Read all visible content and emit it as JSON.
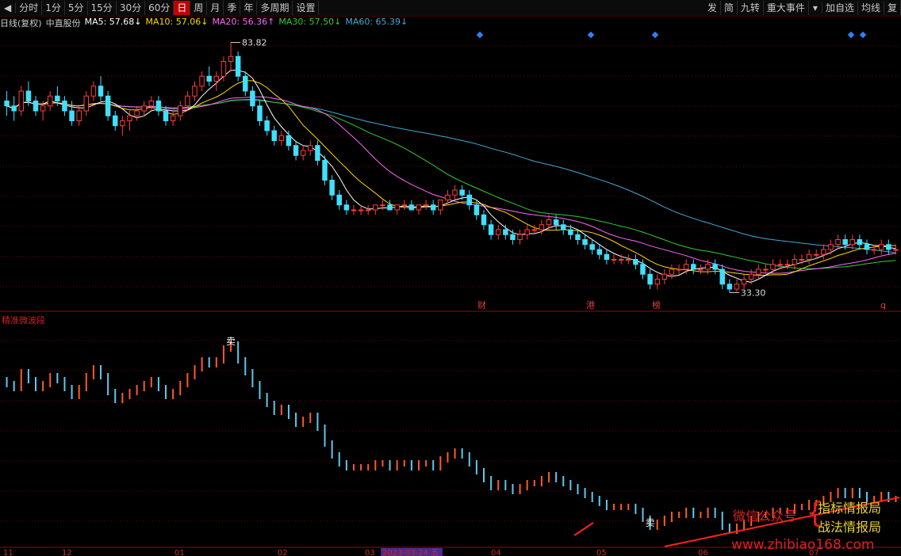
{
  "toolbar": {
    "periods": [
      "分时",
      "1分",
      "5分",
      "15分",
      "30分",
      "60分",
      "日",
      "周",
      "月",
      "季",
      "年",
      "多周期",
      "设置"
    ],
    "active_period": "日",
    "right_items": [
      "发",
      "简",
      "九转",
      "重大事件",
      "加自选",
      "均线",
      "复"
    ]
  },
  "info": {
    "chart_type_label": "日线(复权)",
    "stock_name": "中直股份",
    "ma5": "MA5: 57.68↓",
    "ma10": "MA10: 57.06↓",
    "ma20": "MA20: 56.36↑",
    "ma30": "MA30: 57.50↓",
    "ma60": "MA60: 65.39↓"
  },
  "colors": {
    "up": "#ff3c3c",
    "down": "#40e0ff",
    "ma5": "#ffffff",
    "ma10": "#ffd700",
    "ma20": "#ff66ff",
    "ma30": "#33cc33",
    "ma60": "#3fa9d6",
    "grid": "#7a0000"
  },
  "subchart_title": "精准微波段",
  "event_labels": [
    "财",
    "港",
    "榜",
    "q"
  ],
  "watermark": {
    "line1": "微信公众号",
    "line2": "指标情报局",
    "line3": "战法情报局",
    "url": "www.zhibiao168.com"
  },
  "chart_data": {
    "type": "candlestick",
    "title": "",
    "max_label": "83.82",
    "min_label": "33.30",
    "signal_labels": [
      "卖",
      "卖"
    ],
    "x_ticks": [
      "11",
      "12",
      "01",
      "02",
      "03",
      "2023-03-24 五",
      "04",
      "05",
      "06",
      "07"
    ],
    "ohlc": [
      [
        72,
        74,
        69,
        71
      ],
      [
        71,
        73,
        68,
        70
      ],
      [
        70,
        75,
        69,
        74
      ],
      [
        74,
        76,
        71,
        72
      ],
      [
        72,
        73,
        69,
        70
      ],
      [
        70,
        72,
        68,
        71
      ],
      [
        71,
        74,
        70,
        73
      ],
      [
        73,
        75,
        71,
        72
      ],
      [
        72,
        73,
        69,
        70
      ],
      [
        70,
        72,
        67,
        68
      ],
      [
        68,
        71,
        67,
        70
      ],
      [
        70,
        74,
        69,
        73
      ],
      [
        73,
        76,
        72,
        75
      ],
      [
        75,
        77,
        72,
        73
      ],
      [
        73,
        74,
        68,
        69
      ],
      [
        69,
        70,
        66,
        67
      ],
      [
        67,
        69,
        65,
        68
      ],
      [
        68,
        70,
        66,
        69
      ],
      [
        69,
        71,
        68,
        70
      ],
      [
        70,
        72,
        69,
        71
      ],
      [
        71,
        73,
        70,
        72
      ],
      [
        72,
        73,
        69,
        70
      ],
      [
        70,
        71,
        67,
        68
      ],
      [
        68,
        70,
        67,
        69
      ],
      [
        69,
        72,
        68,
        71
      ],
      [
        71,
        74,
        70,
        73
      ],
      [
        73,
        76,
        72,
        75
      ],
      [
        75,
        78,
        74,
        77
      ],
      [
        77,
        79,
        75,
        76
      ],
      [
        76,
        78,
        74,
        77
      ],
      [
        77,
        81,
        76,
        80
      ],
      [
        80,
        83.82,
        78,
        81
      ],
      [
        81,
        82,
        76,
        77
      ],
      [
        77,
        78,
        73,
        74
      ],
      [
        74,
        75,
        70,
        71
      ],
      [
        71,
        72,
        67,
        68
      ],
      [
        68,
        69,
        65,
        66
      ],
      [
        66,
        67,
        63,
        64
      ],
      [
        64,
        66,
        63,
        65
      ],
      [
        65,
        66,
        62,
        63
      ],
      [
        63,
        64,
        60,
        61
      ],
      [
        61,
        63,
        60,
        62
      ],
      [
        62,
        64,
        61,
        63
      ],
      [
        63,
        64,
        59,
        60
      ],
      [
        60,
        61,
        55,
        56
      ],
      [
        56,
        57,
        52,
        53
      ],
      [
        53,
        54,
        50,
        51
      ],
      [
        51,
        52,
        49,
        50
      ],
      [
        50,
        51,
        49,
        50
      ],
      [
        50,
        51,
        49,
        50
      ],
      [
        50,
        51,
        49,
        50
      ],
      [
        50,
        51,
        49,
        51
      ],
      [
        51,
        52,
        50,
        51
      ],
      [
        51,
        52,
        50,
        50
      ],
      [
        50,
        51,
        49,
        51
      ],
      [
        51,
        52,
        50,
        51
      ],
      [
        51,
        52,
        50,
        50
      ],
      [
        50,
        51,
        49,
        51
      ],
      [
        51,
        52,
        50,
        51
      ],
      [
        51,
        52,
        49,
        50
      ],
      [
        50,
        52,
        49,
        52
      ],
      [
        52,
        54,
        51,
        53
      ],
      [
        53,
        55,
        52,
        54
      ],
      [
        54,
        55,
        52,
        53
      ],
      [
        53,
        54,
        50,
        51
      ],
      [
        51,
        52,
        48,
        49
      ],
      [
        49,
        50,
        46,
        47
      ],
      [
        47,
        48,
        44,
        45
      ],
      [
        45,
        47,
        44,
        46
      ],
      [
        46,
        47,
        44,
        45
      ],
      [
        45,
        46,
        43,
        44
      ],
      [
        44,
        46,
        43,
        45
      ],
      [
        45,
        47,
        44,
        46
      ],
      [
        46,
        47,
        45,
        46
      ],
      [
        46,
        48,
        45,
        47
      ],
      [
        47,
        49,
        46,
        48
      ],
      [
        48,
        49,
        46,
        47
      ],
      [
        47,
        48,
        45,
        46
      ],
      [
        46,
        47,
        44,
        45
      ],
      [
        45,
        46,
        43,
        44
      ],
      [
        44,
        45,
        42,
        43
      ],
      [
        43,
        44,
        41,
        42
      ],
      [
        42,
        43,
        40,
        41
      ],
      [
        41,
        42,
        39,
        40
      ],
      [
        40,
        41,
        39,
        40
      ],
      [
        40,
        41,
        39,
        40
      ],
      [
        40,
        41,
        39,
        40
      ],
      [
        40,
        41,
        38,
        39
      ],
      [
        39,
        40,
        36,
        37
      ],
      [
        37,
        38,
        34,
        35
      ],
      [
        35,
        37,
        34,
        36
      ],
      [
        36,
        38,
        35,
        37
      ],
      [
        37,
        39,
        36,
        38
      ],
      [
        38,
        39,
        37,
        38
      ],
      [
        38,
        40,
        37,
        39
      ],
      [
        39,
        40,
        37,
        38
      ],
      [
        38,
        39,
        37,
        38
      ],
      [
        38,
        40,
        37,
        39
      ],
      [
        39,
        40,
        37,
        38
      ],
      [
        38,
        39,
        34,
        35
      ],
      [
        35,
        36,
        33.3,
        34
      ],
      [
        34,
        36,
        33.5,
        35
      ],
      [
        35,
        37,
        34,
        36
      ],
      [
        36,
        38,
        35,
        37
      ],
      [
        37,
        39,
        36,
        38
      ],
      [
        38,
        39,
        37,
        38
      ],
      [
        38,
        40,
        37,
        39
      ],
      [
        39,
        40,
        38,
        39
      ],
      [
        39,
        40,
        38,
        39
      ],
      [
        39,
        41,
        38,
        40
      ],
      [
        40,
        41,
        39,
        40
      ],
      [
        40,
        42,
        39,
        41
      ],
      [
        41,
        42,
        40,
        41
      ],
      [
        41,
        43,
        40,
        42
      ],
      [
        42,
        44,
        41,
        43
      ],
      [
        43,
        45,
        42,
        44
      ],
      [
        44,
        45,
        42,
        43
      ],
      [
        43,
        45,
        42,
        44
      ],
      [
        44,
        45,
        42,
        43
      ],
      [
        43,
        44,
        41,
        42
      ],
      [
        42,
        43,
        41,
        42
      ],
      [
        42,
        44,
        41,
        43
      ],
      [
        43,
        44,
        41,
        42
      ],
      [
        42,
        43,
        41,
        42
      ]
    ]
  }
}
